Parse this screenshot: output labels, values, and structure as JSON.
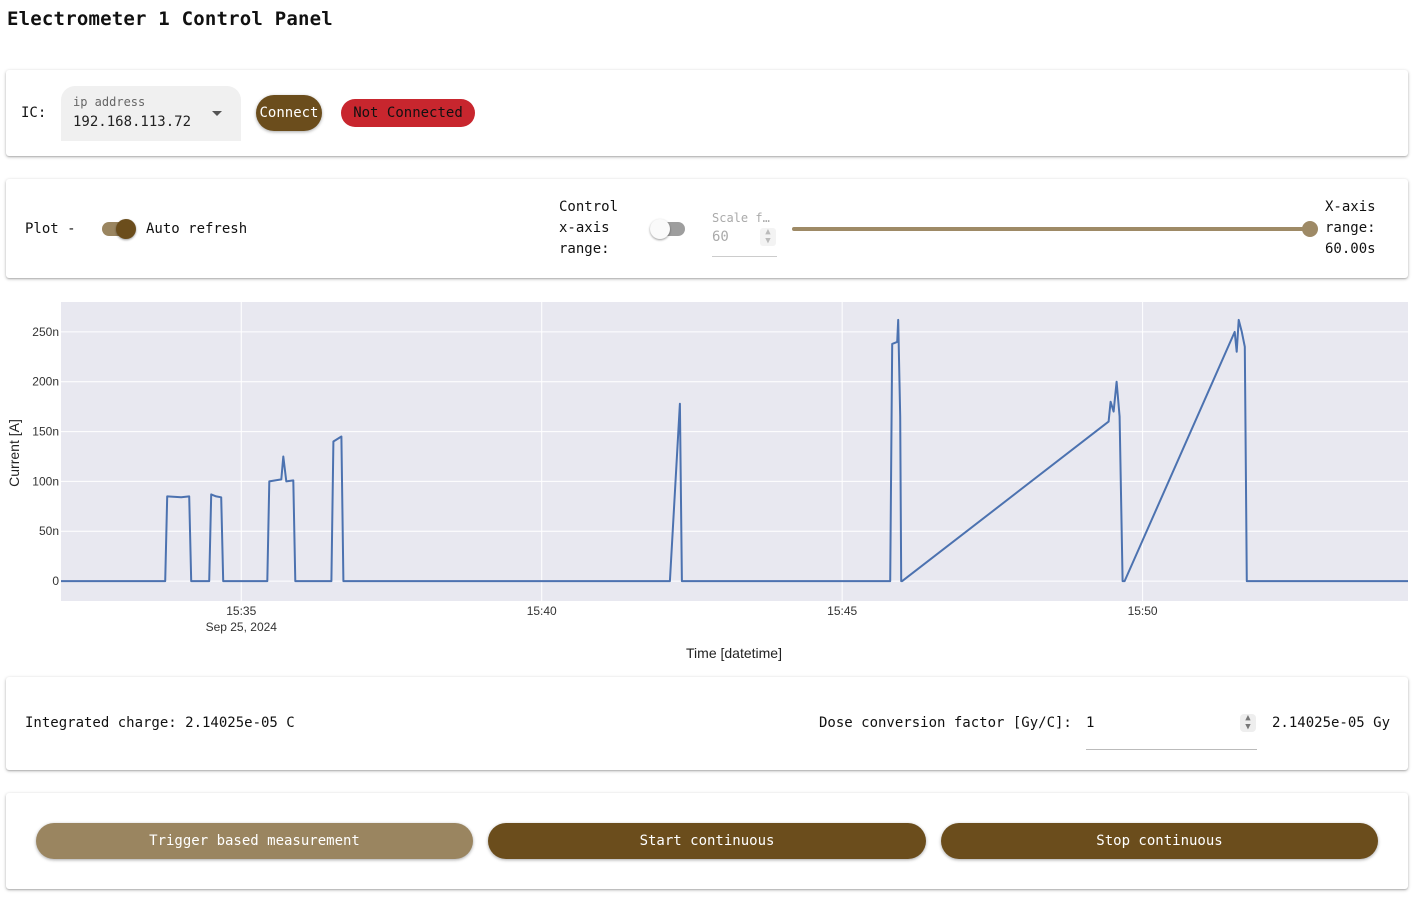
{
  "page": {
    "title": "Electrometer 1 Control Panel"
  },
  "connection": {
    "ic_label": "IC:",
    "ip_label": "ip address",
    "ip_value": "192.168.113.72",
    "connect_label": "Connect",
    "status_label": "Not Connected",
    "status_color": "#c8262e"
  },
  "plot_controls": {
    "plot_label": "Plot -",
    "auto_refresh_label": "Auto refresh",
    "auto_refresh_on": true,
    "control_xrange_label_lines": [
      "Control",
      "x-axis",
      "range:"
    ],
    "control_xrange_on": false,
    "scale_label": "Scale f…",
    "scale_value": "60",
    "slider_level": 1.0,
    "xrange_readout_lines": [
      "X-axis",
      "range:",
      "60.00s"
    ]
  },
  "chart_data": {
    "type": "line",
    "xlabel": "Time [datetime]",
    "ylabel": "Current [A]",
    "x_range": [
      "15:32:00",
      "15:54:25"
    ],
    "ylim": [
      -20,
      280
    ],
    "x_ticks": [
      {
        "t": "15:35:00",
        "label": "15:35",
        "sublabel": "Sep 25, 2024"
      },
      {
        "t": "15:40:00",
        "label": "15:40",
        "sublabel": ""
      },
      {
        "t": "15:45:00",
        "label": "15:45",
        "sublabel": ""
      },
      {
        "t": "15:50:00",
        "label": "15:50",
        "sublabel": ""
      }
    ],
    "y_ticks": [
      {
        "v": 0,
        "label": "0"
      },
      {
        "v": 50,
        "label": "50n"
      },
      {
        "v": 100,
        "label": "100n"
      },
      {
        "v": 150,
        "label": "150n"
      },
      {
        "v": 200,
        "label": "200n"
      },
      {
        "v": 250,
        "label": "250n"
      }
    ],
    "series": [
      {
        "color": "#4c72b0",
        "x": [
          "15:32:00",
          "15:33:44",
          "15:33:46",
          "15:34:00",
          "15:34:08",
          "15:34:10",
          "15:34:28",
          "15:34:30",
          "15:34:35",
          "15:34:40",
          "15:34:42",
          "15:35:26",
          "15:35:28",
          "15:35:40",
          "15:35:42",
          "15:35:45",
          "15:35:52",
          "15:35:54",
          "15:36:30",
          "15:36:32",
          "15:36:40",
          "15:36:42",
          "15:42:08",
          "15:42:18",
          "15:42:20",
          "15:45:48",
          "15:45:50",
          "15:45:55",
          "15:45:56",
          "15:45:58",
          "15:45:59",
          "15:46:00",
          "15:49:26",
          "15:49:28",
          "15:49:31",
          "15:49:34",
          "15:49:37",
          "15:49:40",
          "15:49:42",
          "15:51:32",
          "15:51:34",
          "15:51:36",
          "15:51:39",
          "15:51:42",
          "15:51:44",
          "15:54:25"
        ],
        "y": [
          0,
          0,
          85,
          84,
          85,
          0,
          0,
          87,
          85,
          84,
          0,
          0,
          100,
          102,
          125,
          100,
          101,
          0,
          0,
          140,
          145,
          0,
          0,
          178,
          0,
          0,
          238,
          240,
          262,
          165,
          0,
          0,
          160,
          180,
          170,
          200,
          165,
          0,
          0,
          250,
          230,
          262,
          250,
          235,
          0,
          0
        ]
      }
    ]
  },
  "integration": {
    "charge_text": "Integrated charge: 2.14025e-05 C",
    "dose_factor_label": "Dose conversion factor [Gy/C]:",
    "dose_factor_value": "1",
    "dose_result": "2.14025e-05 Gy"
  },
  "actions": {
    "trigger_label": "Trigger based measurement",
    "start_label": "Start continuous",
    "stop_label": "Stop continuous"
  },
  "colors": {
    "accent": "#6b4d1c",
    "accent_light": "#9a8560",
    "plot_bg": "#e8e8f0",
    "trace": "#4c72b0"
  }
}
